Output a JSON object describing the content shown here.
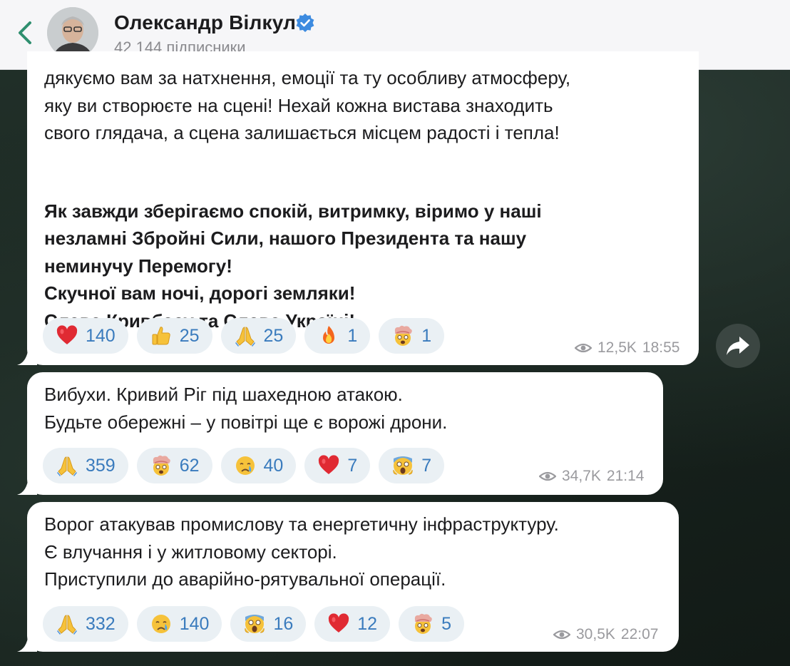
{
  "header": {
    "channel_name": "Олександр Вілкул",
    "subscribers": "42 144 підписники"
  },
  "messages": [
    {
      "lines_regular": "дякуємо вам за натхнення, емоції та ту особливу атмосферу,\nяку ви створюєте на сцені! Нехай кожна вистава знаходить\nсвого глядача, а сцена залишається місцем радості і тепла!",
      "lines_bold": "Як завжди зберігаємо спокій, витримку, віримо у наші\nнезламні Збройні Сили, нашого Президента та нашу\nнеминучу Перемогу!\nСкучної вам ночі, дорогі земляки!\nСлава Кривбасу та Слава Україні!",
      "reactions": [
        {
          "emoji": "heart-emoji",
          "count": "140"
        },
        {
          "emoji": "thumbs-up-emoji",
          "count": "25"
        },
        {
          "emoji": "folded-hands-emoji",
          "count": "25"
        },
        {
          "emoji": "fire-emoji",
          "count": "1"
        },
        {
          "emoji": "exploding-head-emoji",
          "count": "1"
        }
      ],
      "views": "12,5K",
      "time": "18:55"
    },
    {
      "text": "Вибухи. Кривий Ріг під шахедною атакою.\nБудьте обережні – у повітрі ще є ворожі дрони.",
      "reactions": [
        {
          "emoji": "folded-hands-emoji",
          "count": "359"
        },
        {
          "emoji": "exploding-head-emoji",
          "count": "62"
        },
        {
          "emoji": "crying-face-emoji",
          "count": "40"
        },
        {
          "emoji": "heart-emoji",
          "count": "7"
        },
        {
          "emoji": "screaming-face-emoji",
          "count": "7"
        }
      ],
      "views": "34,7K",
      "time": "21:14"
    },
    {
      "text": "Ворог атакував промислову та енергетичну інфраструктуру.\nЄ влучання і у житловому секторі.\nПриступили до аварійно-рятувальної операції.",
      "reactions": [
        {
          "emoji": "folded-hands-emoji",
          "count": "332"
        },
        {
          "emoji": "crying-face-emoji",
          "count": "140"
        },
        {
          "emoji": "screaming-face-emoji",
          "count": "16"
        },
        {
          "emoji": "heart-emoji",
          "count": "12"
        },
        {
          "emoji": "exploding-head-emoji",
          "count": "5"
        }
      ],
      "views": "30,5K",
      "time": "22:07"
    }
  ],
  "colors": {
    "reaction_bg": "#eaf0f4",
    "reaction_count": "#3a7bbd",
    "verified": "#3d8be0",
    "back_arrow": "#2f8f6f"
  }
}
